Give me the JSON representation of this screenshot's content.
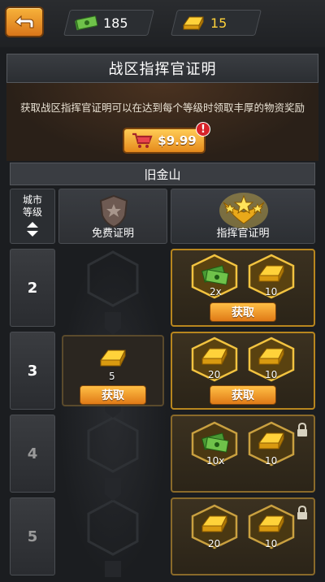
{
  "resources": {
    "cash": "185",
    "gold": "15"
  },
  "panel": {
    "title": "战区指挥官证明",
    "description": "获取战区指挥官证明可以在达到每个等级时领取丰厚的物资奖励",
    "price": "$9.99",
    "alert": "!"
  },
  "city": "旧金山",
  "header": {
    "city_level": "城市",
    "city_level2": "等级",
    "free_pass": "免费证明",
    "commander_pass": "指挥官证明"
  },
  "rows": [
    {
      "level": "2",
      "cmd": [
        {
          "icon": "cash-bundle-icon",
          "qty": "2x"
        },
        {
          "icon": "gold-bar-icon",
          "qty": "10"
        }
      ],
      "cmd_claim": "获取"
    },
    {
      "level": "3",
      "free": {
        "icon": "gold-bar-icon",
        "qty": "5",
        "claim": "获取"
      },
      "cmd": [
        {
          "icon": "gold-bar-icon",
          "qty": "20"
        },
        {
          "icon": "gold-bar-icon",
          "qty": "10"
        }
      ],
      "cmd_claim": "获取"
    },
    {
      "level": "4",
      "cmd": [
        {
          "icon": "cash-bundle-icon",
          "qty": "10x"
        },
        {
          "icon": "gold-bar-icon",
          "qty": "10"
        }
      ],
      "locked": true
    },
    {
      "level": "5",
      "cmd": [
        {
          "icon": "gold-bar-icon",
          "qty": "20"
        },
        {
          "icon": "gold-bar-icon",
          "qty": "10"
        }
      ],
      "locked": true
    }
  ],
  "colors": {
    "accent_orange": "#e58a1c",
    "gold": "#ffd23a",
    "frame_gold": "#b8861e"
  }
}
